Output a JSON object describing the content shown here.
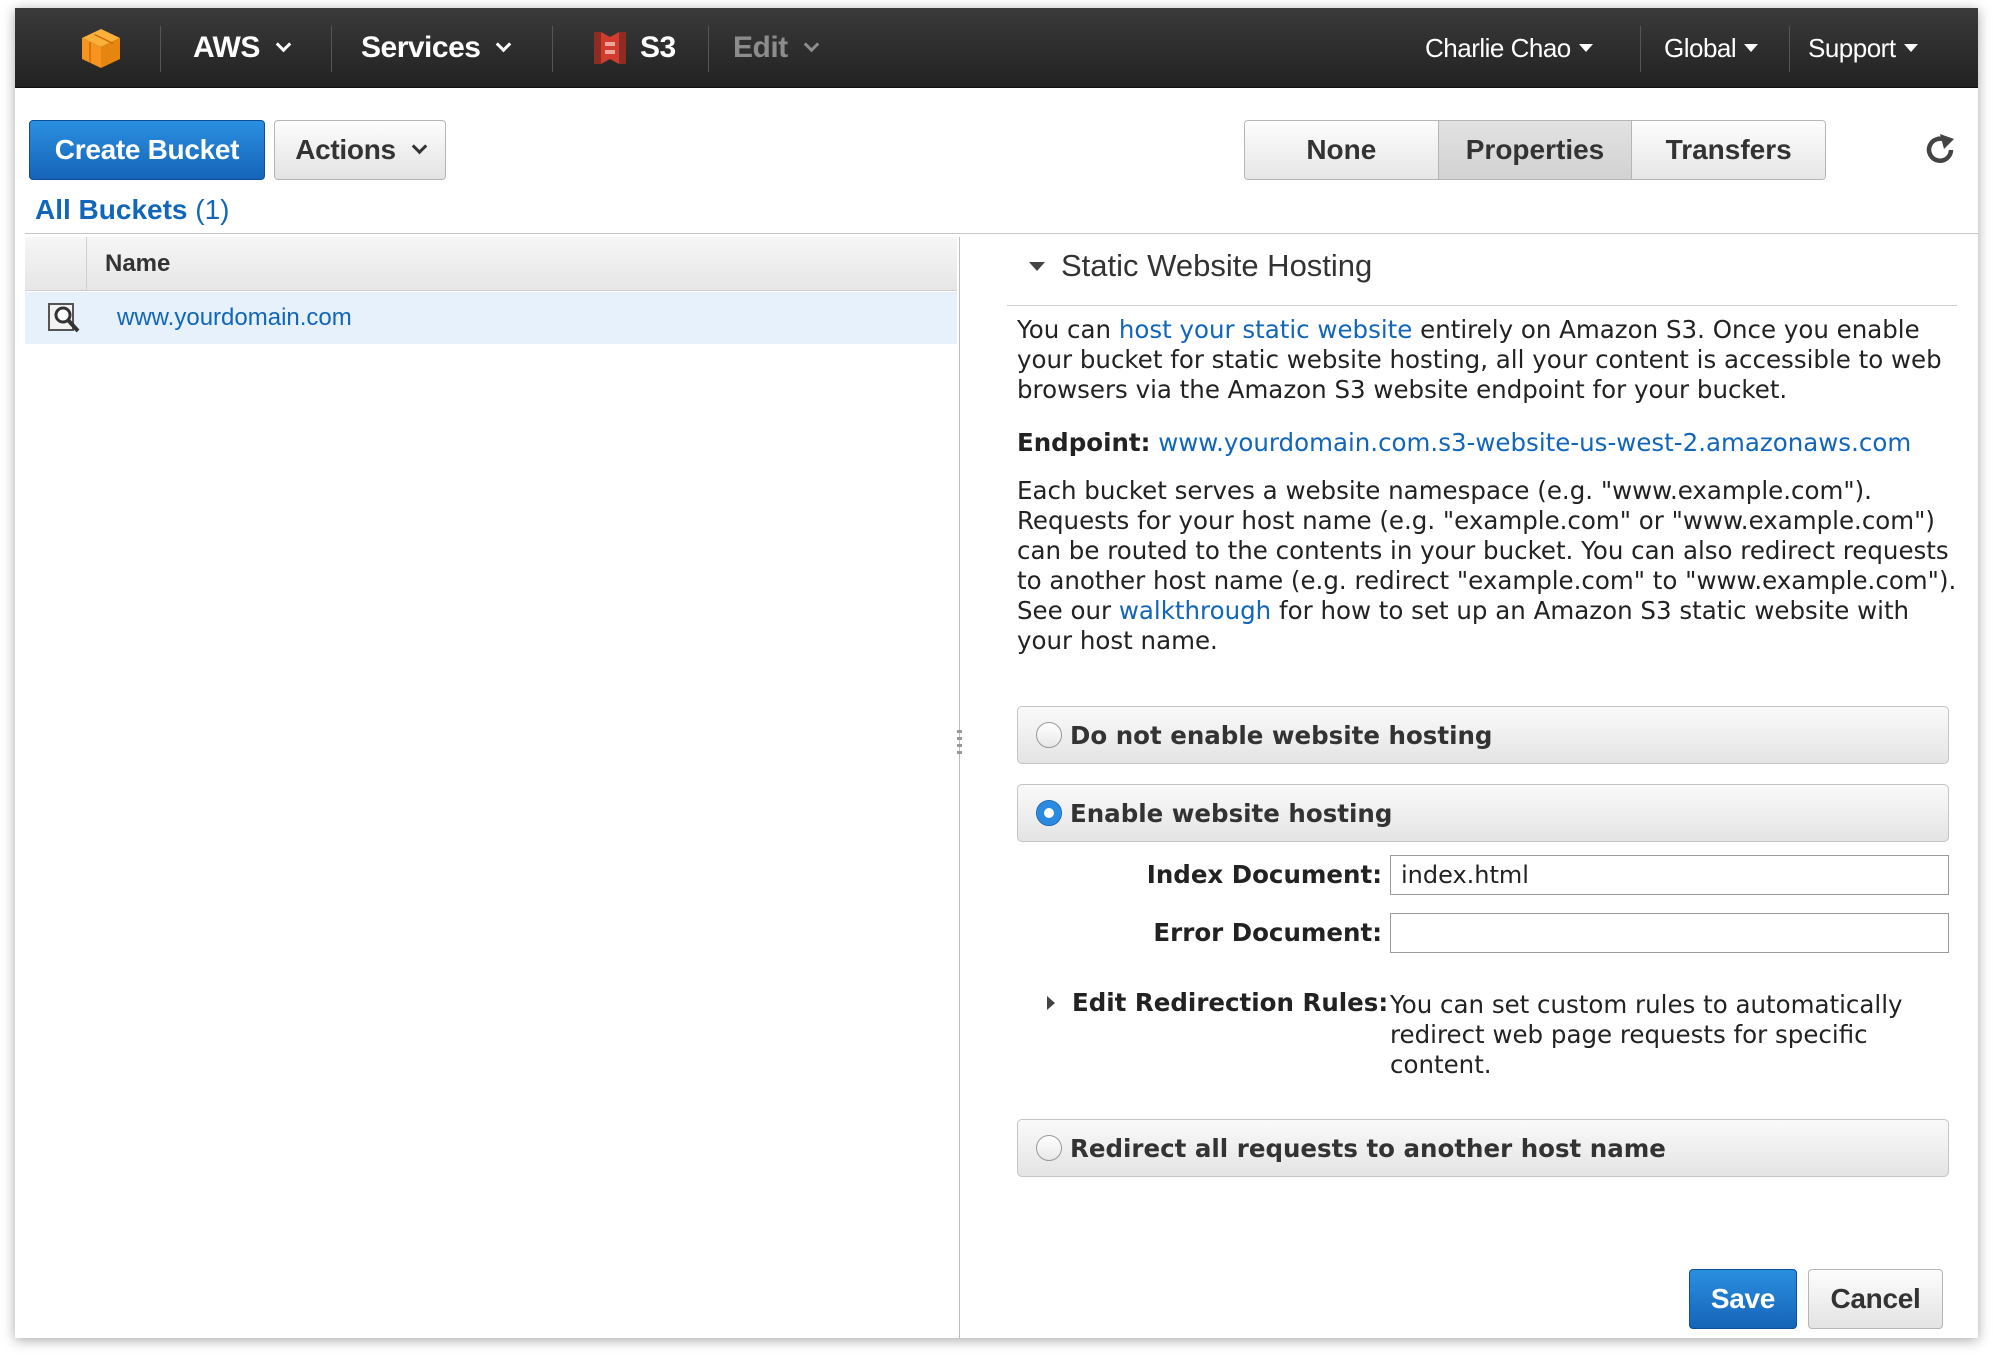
{
  "nav": {
    "aws_label": "AWS",
    "services_label": "Services",
    "s3_label": "S3",
    "edit_label": "Edit",
    "user_label": "Charlie Chao",
    "region_label": "Global",
    "support_label": "Support"
  },
  "toolbar": {
    "create_bucket_label": "Create Bucket",
    "actions_label": "Actions",
    "view_tabs": [
      {
        "label": "None",
        "active": false
      },
      {
        "label": "Properties",
        "active": true
      },
      {
        "label": "Transfers",
        "active": false
      }
    ]
  },
  "buckets": {
    "heading": "All Buckets",
    "count": "(1)",
    "column_name": "Name",
    "rows": [
      {
        "name": "www.yourdomain.com"
      }
    ]
  },
  "hosting": {
    "section_title": "Static Website Hosting",
    "intro_prefix": "You can ",
    "intro_link": "host your static website",
    "intro_suffix": " entirely on Amazon S3. Once you enable your bucket for static website hosting, all your content is accessible to web browsers via the Amazon S3 website endpoint for your bucket.",
    "endpoint_label": "Endpoint:",
    "endpoint_value": "www.yourdomain.com.s3-website-us-west-2.amazonaws.com",
    "namespace_prefix": "Each bucket serves a website namespace (e.g. \"www.example.com\"). Requests for your host name (e.g. \"example.com\" or \"www.example.com\") can be routed to the contents in your bucket. You can also redirect requests to another host name (e.g. redirect \"example.com\" to \"www.example.com\"). See our ",
    "namespace_link": "walkthrough",
    "namespace_suffix": " for how to set up an Amazon S3 static website with your host name.",
    "options": [
      {
        "label": "Do not enable website hosting",
        "selected": false
      },
      {
        "label": "Enable website hosting",
        "selected": true
      },
      {
        "label": "Redirect all requests to another host name",
        "selected": false
      }
    ],
    "index_label": "Index Document:",
    "index_value": "index.html",
    "error_label": "Error Document:",
    "error_value": "",
    "redirection_label": "Edit Redirection Rules:",
    "redirection_desc": "You can set custom rules to automatically redirect web page requests for specific content."
  },
  "footer": {
    "save_label": "Save",
    "cancel_label": "Cancel"
  },
  "colors": {
    "nav_bg": "#2b2b2b",
    "primary_blue": "#1f7ad0",
    "link_blue": "#1166bb",
    "selection_bg": "#e6f1fb",
    "aws_orange": "#f79400",
    "s3_red": "#d23c2f"
  },
  "icons": {
    "aws_logo": "aws-cube-icon",
    "s3_logo": "s3-bucket-icon",
    "refresh": "refresh-icon",
    "bucket_row": "bucket-search-icon"
  }
}
